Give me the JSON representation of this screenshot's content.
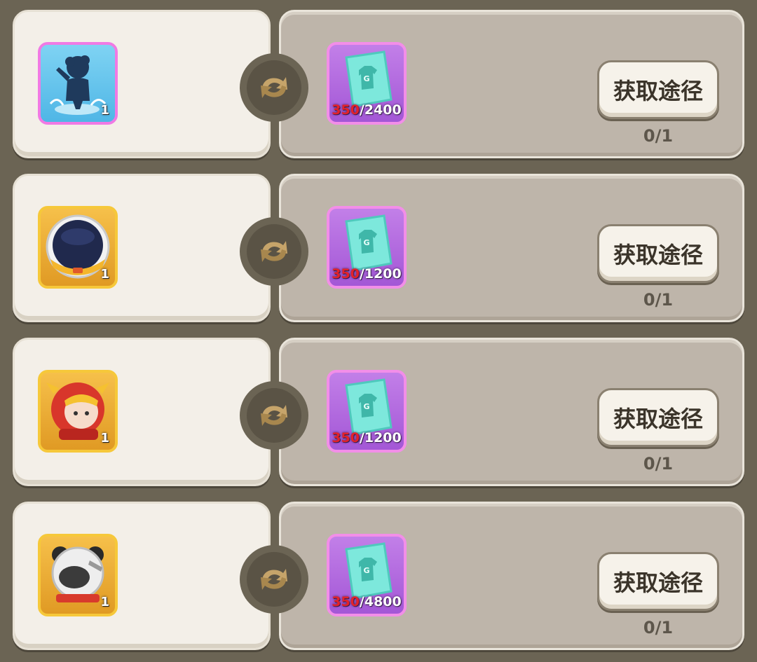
{
  "rows": [
    {
      "costume": {
        "icon": "shadow-character-costume-icon",
        "qty": "1",
        "frame": "pink"
      },
      "ticket": {
        "icon": "costume-ticket-icon",
        "have": "350",
        "need": "/2400"
      },
      "button_label": "获取途径",
      "progress": "0/1"
    },
    {
      "costume": {
        "icon": "astronaut-helmet-icon",
        "qty": "1",
        "frame": "gold"
      },
      "ticket": {
        "icon": "costume-ticket-icon",
        "have": "350",
        "need": "/1200"
      },
      "button_label": "获取途径",
      "progress": "0/1"
    },
    {
      "costume": {
        "icon": "red-dragon-hood-icon",
        "qty": "1",
        "frame": "gold"
      },
      "ticket": {
        "icon": "costume-ticket-icon",
        "have": "350",
        "need": "/1200"
      },
      "button_label": "获取途径",
      "progress": "0/1"
    },
    {
      "costume": {
        "icon": "panda-helmet-icon",
        "qty": "1",
        "frame": "gold"
      },
      "ticket": {
        "icon": "costume-ticket-icon",
        "have": "350",
        "need": "/4800"
      },
      "button_label": "获取途径",
      "progress": "0/1"
    }
  ],
  "colors": {
    "have_count": "#e3222a",
    "ticket_bg": "#a357d6",
    "gold_frame": "#f6c83a",
    "pink_frame": "#f07ae4"
  }
}
